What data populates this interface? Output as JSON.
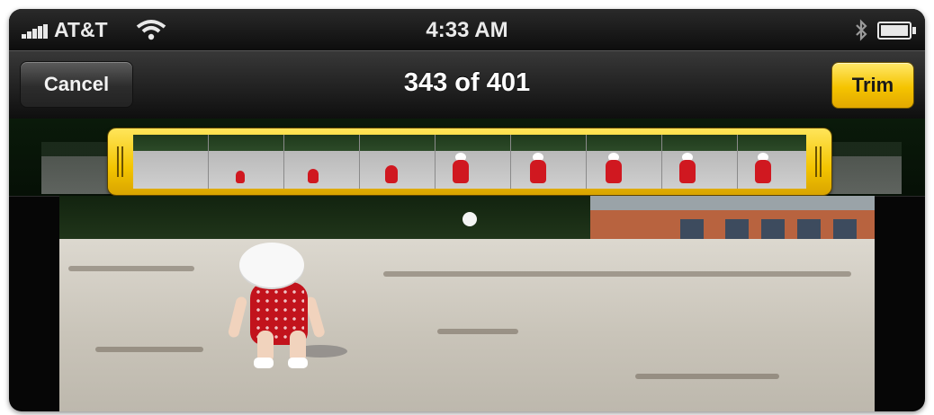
{
  "status_bar": {
    "carrier": "AT&T",
    "time": "4:33 AM",
    "signal_icon": "signal-bars-icon",
    "wifi_icon": "wifi-icon",
    "bluetooth_icon": "bluetooth-icon",
    "battery_icon": "battery-icon"
  },
  "nav_bar": {
    "cancel_label": "Cancel",
    "title": "343 of 401",
    "trim_label": "Trim"
  },
  "colors": {
    "trim_accent": "#f5c400",
    "nav_background": "#1e1e1e"
  }
}
